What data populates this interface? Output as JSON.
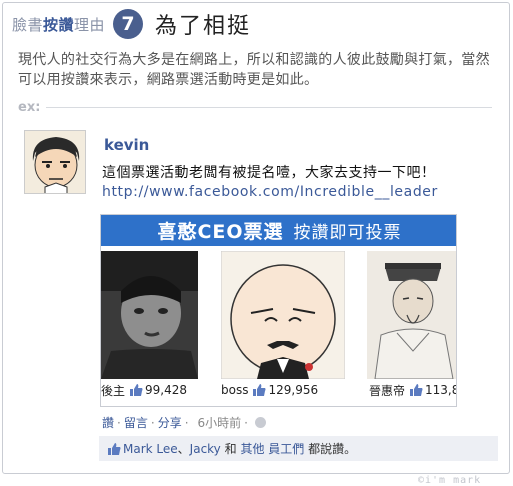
{
  "header": {
    "prefix": "臉書",
    "prefix_bold": "按讚",
    "prefix_suffix": "理由",
    "number": "7",
    "title": "為了相挺"
  },
  "intro": "現代人的社交行為大多是在網路上，所以和認識的人彼此鼓勵與打氣，當然可以用按讚來表示，網路票選活動時更是如此。",
  "example_label": "ex:",
  "post": {
    "author": "kevin",
    "text": "這個票選活動老闆有被提名噎，大家去支持一下吧！",
    "link": "http://www.facebook.com/Incredible__leader"
  },
  "poll": {
    "banner_main": "喜憨CEO票選",
    "banner_sub": "按讚即可投票",
    "candidates": [
      {
        "name": "後主",
        "votes": "99,428"
      },
      {
        "name": "boss",
        "votes": "129,956"
      },
      {
        "name": "晉惠帝",
        "votes": "113,8"
      }
    ]
  },
  "actions": {
    "like": "讚",
    "comment": "留言",
    "share": "分享",
    "time": "6小時前"
  },
  "likes_bar": {
    "name1": "Mark Lee",
    "sep": "、",
    "name2": "Jacky",
    "and": " 和 ",
    "others": "其他 員工們",
    "suffix": " 都說讚。"
  },
  "watermark": "©i'm mark",
  "colors": {
    "facebook_blue": "#3b5998",
    "banner_blue": "#2e71c9",
    "badge": "#4a5f8e"
  }
}
